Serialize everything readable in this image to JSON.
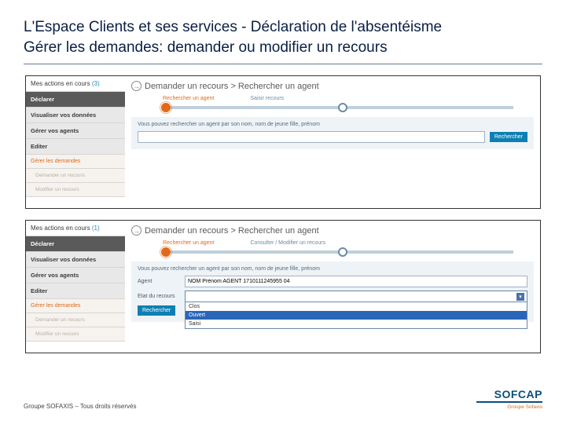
{
  "title": {
    "line1": "L'Espace Clients et ses services - Déclaration de l'absentéisme",
    "line2": "Gérer les demandes: demander ou modifier un recours"
  },
  "sidebar": {
    "actions_label": "Mes actions en cours",
    "count_top": "(3)",
    "count_bottom": "(1)",
    "declarer": "Déclarer",
    "visualiser": "Visualiser vos données",
    "gerer_agents": "Gérer vos agents",
    "editer": "Editer",
    "gerer_demandes": "Gérer les demandes",
    "sub_demander": "Demander un recours",
    "sub_modifier": "Modifier un recours"
  },
  "content": {
    "breadcrumb": "Demander un recours > Rechercher un agent",
    "step1": "Rechercher un agent",
    "step2_top": "Saisir recours",
    "step2_bottom": "Consulter / Modifier un recours",
    "hint": "Vous pouvez rechercher un agent par son nom, nom de jeune fille, prénom",
    "search_btn": "Rechercher",
    "agent_label": "Agent",
    "etat_label": "Etat du recours",
    "agent_value": "NOM Prénom AGENT 1710111245955 04",
    "dd": {
      "opt1": "Clos",
      "opt2": "Ouvert",
      "opt3": "Saisi"
    }
  },
  "footer": {
    "copy": "Groupe SOFAXIS – Tous droits réservés",
    "brand": "SOFCAP",
    "sub": "Groupe Sofaxis"
  }
}
